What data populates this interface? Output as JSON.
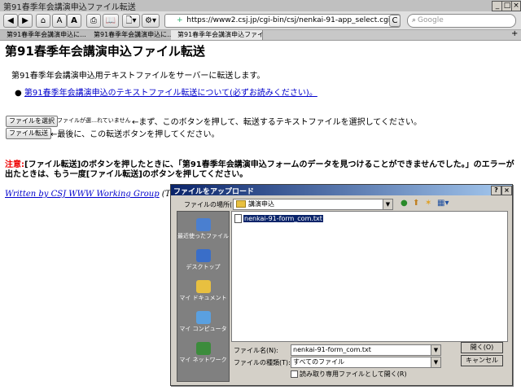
{
  "window": {
    "title": "第91春季年会講演申込ファイル転送"
  },
  "toolbar": {
    "back": "◀",
    "forward": "▶",
    "home": "⌂",
    "text_small": "A",
    "text_large": "A",
    "print": "⎙",
    "bookmarks": "📖",
    "page": "🗋▾",
    "gear": "⚙▾",
    "add": "+",
    "url": "https://www2.csj.jp/cgi-bin/csj/nenkai-91-app_select.cgi?_keyword=",
    "search_placeholder": "Google"
  },
  "tabs": [
    {
      "label": "第91春季年会講演申込に..."
    },
    {
      "label": "第91春季年会講演申込に..."
    },
    {
      "label": "第91春季年会講演申込ファイ..."
    }
  ],
  "page": {
    "heading": "第91春季年会講演申込ファイル転送",
    "intro": "第91春季年会講演申込用テキストファイルをサーバーに転送します。",
    "link": "第91春季年会講演申込のテキストファイル転送について(必ずお読みください)。",
    "choose_button": "ファイルを選択",
    "no_file": "ファイルが選…れていません",
    "choose_desc": "←まず、このボタンを押して、転送するテキストファイルを選択してください。",
    "upload_button": "ファイル転送",
    "upload_desc": "←最後に、この転送ボタンを押してください。",
    "note_label": "注意:",
    "note_line1": "[ファイル転送]のボタンを押したときに、「第91春季年会講演申込フォームのデータを見つけることができませんでした。」のエラーが",
    "note_line2": "出たときは、もう一度[ファイル転送]のボタンを押してください。",
    "footer_link": "Written by CSJ WWW Working Group",
    "footer_rest": " (TOYODA"
  },
  "dialog": {
    "title": "ファイルをアップロード",
    "help": "?",
    "close": "×",
    "location_label": "ファイルの場所(I):",
    "location_value": "講演申込",
    "places": [
      {
        "label": "最近使ったファイル",
        "icon": "recent-files-icon",
        "color": "#4a7fd0"
      },
      {
        "label": "デスクトップ",
        "icon": "desktop-icon",
        "color": "#3a6ec8"
      },
      {
        "label": "マイ ドキュメント",
        "icon": "my-documents-icon",
        "color": "#e8c040"
      },
      {
        "label": "マイ コンピュータ",
        "icon": "my-computer-icon",
        "color": "#5aa0e0"
      },
      {
        "label": "マイ ネットワーク",
        "icon": "my-network-icon",
        "color": "#3c8c3c"
      }
    ],
    "files": [
      "nenkai-91-form_com.txt"
    ],
    "filename_label": "ファイル名(N):",
    "filename_value": "nenkai-91-form_com.txt",
    "filetype_label": "ファイルの種類(T):",
    "filetype_value": "すべてのファイル",
    "readonly_label": "読み取り専用ファイルとして開く(R)",
    "open_button": "開く(O)",
    "cancel_button": "キャンセル"
  }
}
